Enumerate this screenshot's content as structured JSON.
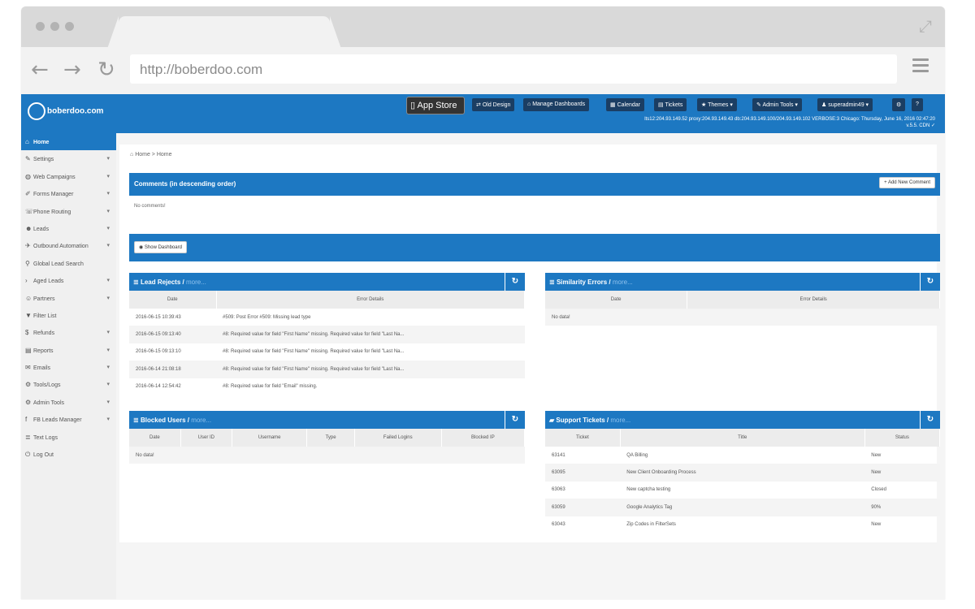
{
  "browser": {
    "url": "http://boberdoo.com"
  },
  "topnav": {
    "logo_text": "boberdoo.com",
    "appstore_small": "Available on the iPhone",
    "appstore_label": "App Store",
    "buttons": [
      "Old Design",
      "Manage Dashboards",
      "Calendar",
      "Tickets",
      "Themes ▾",
      "Admin Tools ▾",
      "superadmin49 ▾"
    ],
    "info_line1": "lts12:204.93.149.52 proxy:204.93.149.43 db:204.93.149.100/204.93.149.102 VERBOSE:3   Chicago: Thursday, June 16, 2016 02:47:20",
    "info_line2": "v.5.5. CDN ✓"
  },
  "sidebar": {
    "items": [
      {
        "label": "Home",
        "icon": "home-icon",
        "active": true,
        "caret": false
      },
      {
        "label": "Settings",
        "icon": "wrench-icon",
        "active": false,
        "caret": true
      },
      {
        "label": "Web Campaigns",
        "icon": "globe-icon",
        "active": false,
        "caret": true
      },
      {
        "label": "Forms Manager",
        "icon": "edit-icon",
        "active": false,
        "caret": true
      },
      {
        "label": "Phone Routing",
        "icon": "phone-icon",
        "active": false,
        "caret": true
      },
      {
        "label": "Leads",
        "icon": "users-icon",
        "active": false,
        "caret": true
      },
      {
        "label": "Outbound Automation",
        "icon": "plane-icon",
        "active": false,
        "caret": true
      },
      {
        "label": "Global Lead Search",
        "icon": "search-icon",
        "active": false,
        "caret": false
      },
      {
        "label": "Aged Leads",
        "icon": "chevron-right-icon",
        "active": false,
        "caret": true
      },
      {
        "label": "Partners",
        "icon": "partners-icon",
        "active": false,
        "caret": true
      },
      {
        "label": "Filter List",
        "icon": "filter-icon",
        "active": false,
        "caret": false
      },
      {
        "label": "Refunds",
        "icon": "money-icon",
        "active": false,
        "caret": true
      },
      {
        "label": "Reports",
        "icon": "reports-icon",
        "active": false,
        "caret": true
      },
      {
        "label": "Emails",
        "icon": "envelope-icon",
        "active": false,
        "caret": true
      },
      {
        "label": "Tools/Logs",
        "icon": "gear-icon",
        "active": false,
        "caret": true
      },
      {
        "label": "Admin Tools",
        "icon": "cog-icon",
        "active": false,
        "caret": true
      },
      {
        "label": "FB Leads Manager",
        "icon": "facebook-icon",
        "active": false,
        "caret": true
      },
      {
        "label": "Text Logs",
        "icon": "list-icon",
        "active": false,
        "caret": false
      },
      {
        "label": "Log Out",
        "icon": "power-icon",
        "active": false,
        "caret": false
      }
    ]
  },
  "breadcrumb": "Home > Home",
  "comments": {
    "title": "Comments (in descending order)",
    "add_button": "Add New Comment",
    "empty": "No comments!"
  },
  "dashboard": {
    "show_button": "Show Dashboard"
  },
  "lead_rejects": {
    "title": "Lead Rejects / ",
    "more": "more...",
    "columns": [
      "Date",
      "Error Details"
    ],
    "rows": [
      [
        "2016-06-15 10:39:43",
        "#509: Post Error #509: Missing lead type"
      ],
      [
        "2016-06-15 09:13:40",
        "#8: Required value for field \"First Name\" missing. Required value for field \"Last Na..."
      ],
      [
        "2016-06-15 09:13:10",
        "#8: Required value for field \"First Name\" missing. Required value for field \"Last Na..."
      ],
      [
        "2016-06-14 21:08:18",
        "#8: Required value for field \"First Name\" missing. Required value for field \"Last Na..."
      ],
      [
        "2016-06-14 12:54:42",
        "#8: Required value for field \"Email\" missing."
      ]
    ]
  },
  "similarity_errors": {
    "title": "Similarity Errors / ",
    "more": "more...",
    "columns": [
      "Date",
      "Error Details"
    ],
    "empty": "No data!"
  },
  "blocked_users": {
    "title": "Blocked Users / ",
    "more": "more...",
    "columns": [
      "Date",
      "User ID",
      "Username",
      "Type",
      "Failed Logins",
      "Blocked IP"
    ],
    "empty": "No data!"
  },
  "support_tickets": {
    "title": "Support Tickets / ",
    "more": "more...",
    "columns": [
      "Ticket",
      "Title",
      "Status"
    ],
    "rows": [
      [
        "63141",
        "QA Billing",
        "New"
      ],
      [
        "63095",
        "New Client Onboarding Process",
        "New"
      ],
      [
        "63063",
        "New captcha testing",
        "Closed"
      ],
      [
        "63059",
        "Google Analytics Tag",
        "90%"
      ],
      [
        "63043",
        "Zip Codes in FilterSets",
        "New"
      ]
    ]
  },
  "colors": {
    "brand_blue": "#1d78c2",
    "dark_button": "#1b3e63"
  }
}
